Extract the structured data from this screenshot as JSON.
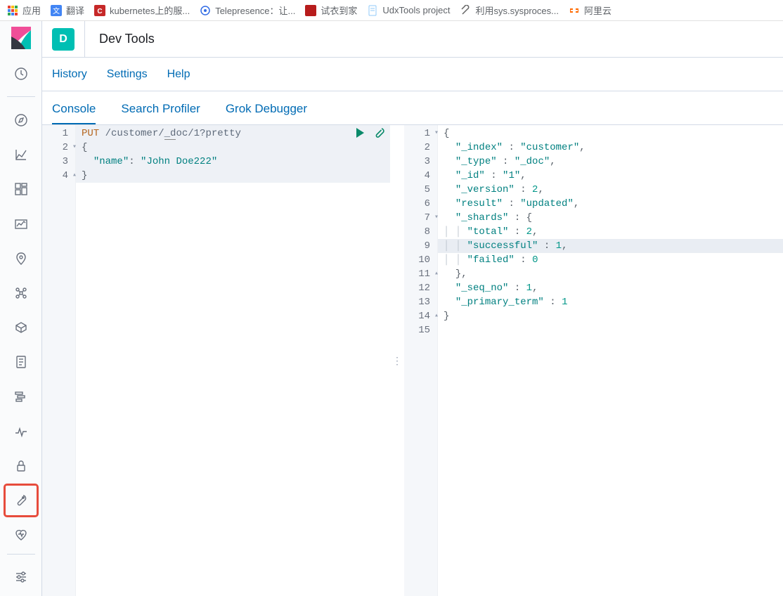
{
  "bookmarks": [
    {
      "label": "应用"
    },
    {
      "label": "翻译"
    },
    {
      "label": "kubernetes上的服..."
    },
    {
      "label": "Telepresence：让..."
    },
    {
      "label": "试衣到家"
    },
    {
      "label": "UdxTools project"
    },
    {
      "label": "利用sys.sysproces..."
    },
    {
      "label": "阿里云"
    }
  ],
  "app": {
    "badge": "D",
    "title": "Dev Tools"
  },
  "subnav": {
    "history": "History",
    "settings": "Settings",
    "help": "Help"
  },
  "tabs": {
    "console": "Console",
    "profiler": "Search Profiler",
    "grok": "Grok Debugger"
  },
  "request": {
    "method": "PUT",
    "path": "/customer/_doc/1?pretty",
    "body_lines": [
      "{",
      "  \"name\": \"John Doe222\"",
      "}"
    ]
  },
  "request_gutter": [
    "1",
    "2",
    "3",
    "4"
  ],
  "response_gutter": [
    "1",
    "2",
    "3",
    "4",
    "5",
    "6",
    "7",
    "8",
    "9",
    "10",
    "11",
    "12",
    "13",
    "14",
    "15"
  ],
  "response_lines": [
    {
      "indent": 0,
      "raw": "{",
      "fold": "down"
    },
    {
      "indent": 1,
      "key": "_index",
      "val": "\"customer\"",
      "type": "str",
      "comma": true
    },
    {
      "indent": 1,
      "key": "_type",
      "val": "\"_doc\"",
      "type": "str",
      "comma": true
    },
    {
      "indent": 1,
      "key": "_id",
      "val": "\"1\"",
      "type": "str",
      "comma": true
    },
    {
      "indent": 1,
      "key": "_version",
      "val": "2",
      "type": "num",
      "comma": true
    },
    {
      "indent": 1,
      "key": "result",
      "val": "\"updated\"",
      "type": "str",
      "comma": true
    },
    {
      "indent": 1,
      "key": "_shards",
      "val": "{",
      "type": "punc",
      "comma": false,
      "fold": "down"
    },
    {
      "indent": 2,
      "key": "total",
      "val": "2",
      "type": "num",
      "comma": true,
      "guide": true
    },
    {
      "indent": 2,
      "key": "successful",
      "val": "1",
      "type": "num",
      "comma": true,
      "guide": true,
      "hl": true
    },
    {
      "indent": 2,
      "key": "failed",
      "val": "0",
      "type": "num",
      "comma": false,
      "guide": true
    },
    {
      "indent": 1,
      "raw": "},",
      "fold": "up"
    },
    {
      "indent": 1,
      "key": "_seq_no",
      "val": "1",
      "type": "num",
      "comma": true
    },
    {
      "indent": 1,
      "key": "_primary_term",
      "val": "1",
      "type": "num",
      "comma": false
    },
    {
      "indent": 0,
      "raw": "}",
      "fold": "up"
    },
    {
      "indent": 0,
      "raw": ""
    }
  ]
}
